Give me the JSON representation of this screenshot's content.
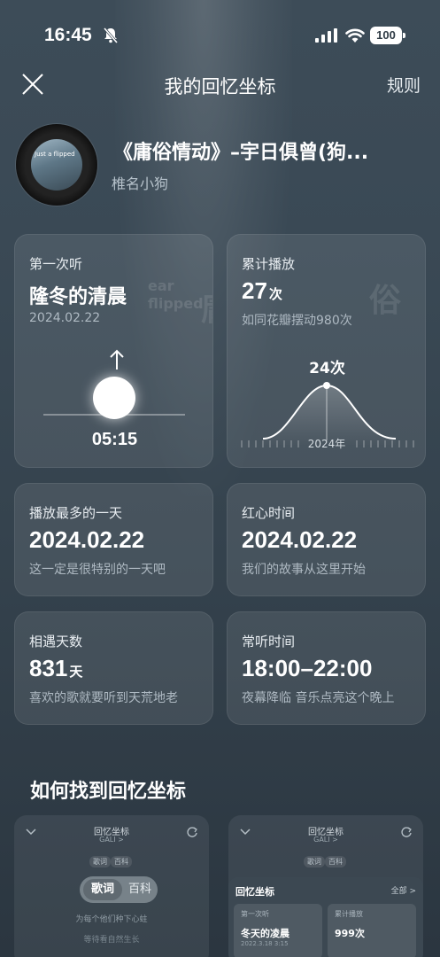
{
  "status_bar": {
    "time": "16:45",
    "battery": "100"
  },
  "nav": {
    "title": "我的回忆坐标",
    "rules": "规则"
  },
  "song": {
    "title": "《庸俗情动》–宇日俱曾(狗...",
    "artist": "椎名小狗"
  },
  "cards": {
    "first_listen": {
      "label": "第一次听",
      "value": "隆冬的清晨",
      "date": "2024.02.22",
      "time": "05:15"
    },
    "total_plays": {
      "label": "累计播放",
      "value": "27",
      "unit": "次",
      "sub": "如同花瓣摆动980次",
      "peak": "24次",
      "year": "2024年"
    },
    "most_played_day": {
      "label": "播放最多的一天",
      "value": "2024.02.22",
      "sub": "这一定是很特别的一天吧"
    },
    "heart_time": {
      "label": "红心时间",
      "value": "2024.02.22",
      "sub": "我们的故事从这里开始"
    },
    "days_met": {
      "label": "相遇天数",
      "value": "831",
      "unit": "天",
      "sub": "喜欢的歌就要听到天荒地老"
    },
    "usual_time": {
      "label": "常听时间",
      "value": "18:00–22:00",
      "sub": "夜幕降临 音乐点亮这个晚上"
    }
  },
  "watermarks": {
    "card1_a": "ear",
    "card1_b": "flipped",
    "card1_c": "庸",
    "card2": "俗",
    "vinyl": "Just a flipped"
  },
  "guide": {
    "title": "如何找到回忆坐标",
    "left": {
      "header": "回忆坐标",
      "sub": "GALI >",
      "tab_lyrics": "歌词",
      "tab_wiki": "百科",
      "line1": "为每个他们种下心蛀",
      "line2": "等待看自然生长"
    },
    "right": {
      "header": "回忆坐标",
      "sub": "GALI >",
      "tab_lyrics": "歌词",
      "tab_wiki": "百科",
      "popup_title": "回忆坐标",
      "popup_all": "全部 >",
      "first_label": "第一次听",
      "first_value": "冬天的凌晨",
      "first_date": "2022.3.18 3:15",
      "plays_label": "累计播放",
      "plays_value": "999次"
    }
  },
  "colors": {
    "background": "#3a4955",
    "card": "rgba(255,255,255,0.09)",
    "text": "#ffffff",
    "muted": "#aeb9c2"
  },
  "icons": [
    "bell-slash-icon",
    "signal-icon",
    "wifi-icon",
    "close-icon",
    "arrow-up-icon",
    "chevron-down-icon",
    "refresh-icon"
  ]
}
